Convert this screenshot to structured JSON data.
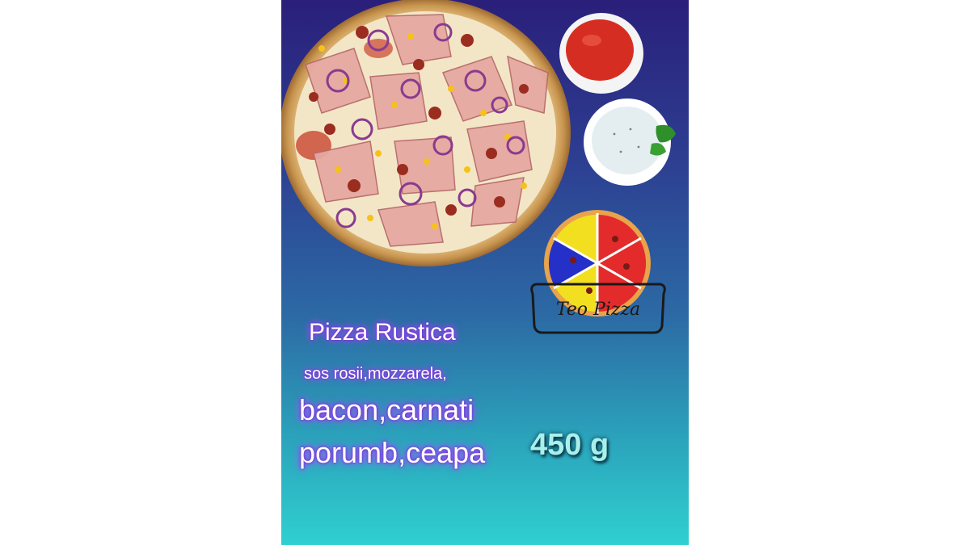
{
  "product": {
    "name": "Pizza Rustica",
    "ingredients_line1": "sos rosii,mozzarela,",
    "ingredients_line2": "bacon,carnati",
    "ingredients_line3": "porumb,ceapa",
    "weight": "450 g"
  },
  "brand": {
    "logo_text": "Teo Pizza"
  },
  "colors": {
    "background_top": "#2a1f7a",
    "background_bottom": "#2fd0d0",
    "text_glow": "#a456ff",
    "weight_text": "#a8f0ec"
  }
}
